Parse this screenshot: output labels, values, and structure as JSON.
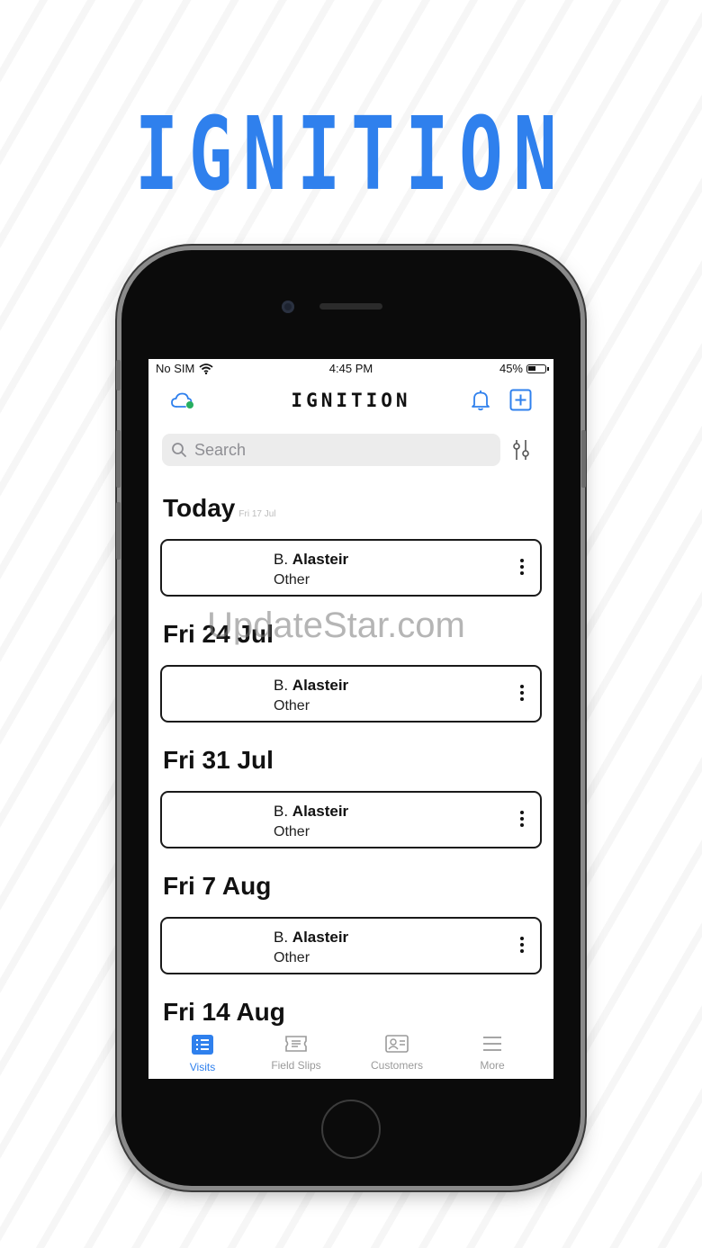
{
  "promo": {
    "title": "IGNITION"
  },
  "watermark": "UpdateStar.com",
  "status_bar": {
    "carrier": "No SIM",
    "time": "4:45 PM",
    "battery": "45%"
  },
  "header": {
    "title": "IGNITION"
  },
  "search": {
    "placeholder": "Search"
  },
  "sections": [
    {
      "date": "Today",
      "sub": "Fri 17 Jul",
      "card": {
        "initial": "B.",
        "name": "Alasteir",
        "type": "Other"
      }
    },
    {
      "date": "Fri 24 Jul",
      "sub": "",
      "card": {
        "initial": "B.",
        "name": "Alasteir",
        "type": "Other"
      }
    },
    {
      "date": "Fri 31 Jul",
      "sub": "",
      "card": {
        "initial": "B.",
        "name": "Alasteir",
        "type": "Other"
      }
    },
    {
      "date": "Fri 7 Aug",
      "sub": "",
      "card": {
        "initial": "B.",
        "name": "Alasteir",
        "type": "Other"
      }
    },
    {
      "date": "Fri 14 Aug",
      "sub": ""
    }
  ],
  "tabs": [
    {
      "label": "Visits",
      "icon": "list-icon",
      "active": true
    },
    {
      "label": "Field Slips",
      "icon": "ticket-icon",
      "active": false
    },
    {
      "label": "Customers",
      "icon": "contact-card-icon",
      "active": false
    },
    {
      "label": "More",
      "icon": "menu-icon",
      "active": false
    }
  ],
  "colors": {
    "accent": "#2f80ed",
    "cloud_status": "#27ae60"
  }
}
